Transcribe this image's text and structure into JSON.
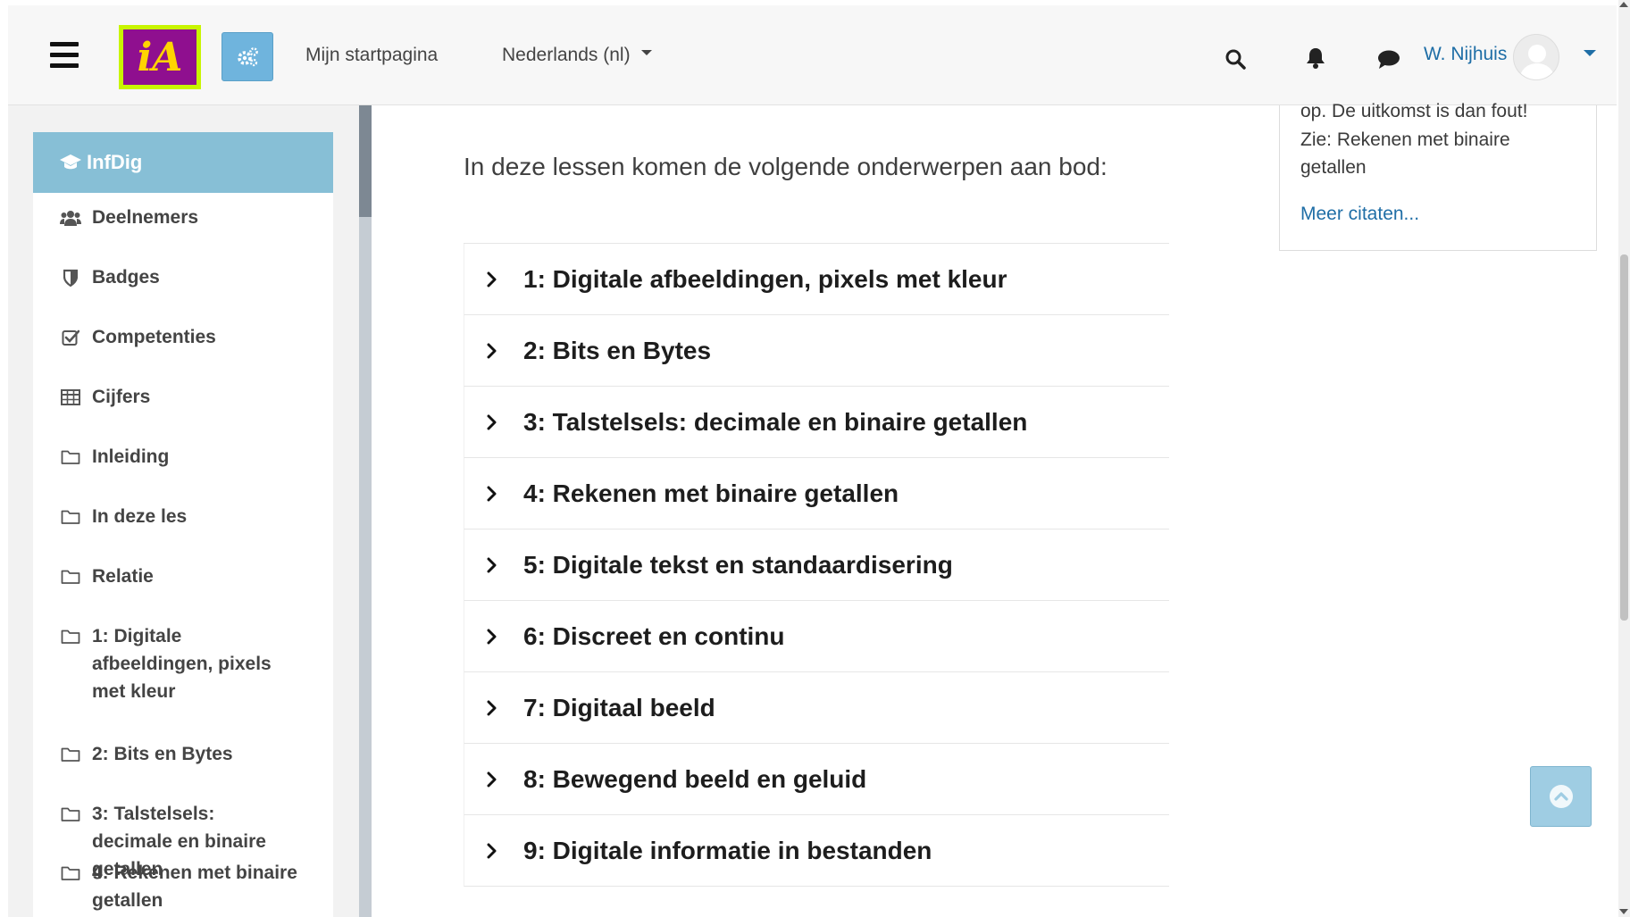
{
  "navbar": {
    "logo_text": "iA",
    "home_link": "Mijn startpagina",
    "language_label": "Nederlands (nl)",
    "user_name": "W. Nijhuis",
    "icons": [
      "menu-icon",
      "cogs-icon",
      "search-icon",
      "bell-icon",
      "comment-icon",
      "avatar",
      "caret-down-icon"
    ]
  },
  "drawer": {
    "course": {
      "label": "InfDig",
      "icon": "graduation-cap-icon"
    },
    "items": [
      {
        "label": "Deelnemers",
        "icon": "users-icon"
      },
      {
        "label": "Badges",
        "icon": "shield-icon"
      },
      {
        "label": "Competenties",
        "icon": "check-square-icon"
      },
      {
        "label": "Cijfers",
        "icon": "table-icon"
      },
      {
        "label": "Inleiding",
        "icon": "folder-icon"
      },
      {
        "label": "In deze les",
        "icon": "folder-icon"
      },
      {
        "label": "Relatie",
        "icon": "folder-icon"
      },
      {
        "label": "1: Digitale afbeeldingen, pixels met kleur",
        "icon": "folder-icon"
      },
      {
        "label": "2: Bits en Bytes",
        "icon": "folder-icon"
      },
      {
        "label": "3: Talstelsels: decimale en binaire getallen",
        "icon": "folder-icon"
      },
      {
        "label": "4: Rekenen met binaire getallen",
        "icon": "folder-icon"
      }
    ]
  },
  "main": {
    "intro": "In deze lessen komen de volgende onderwerpen aan bod:",
    "topics": [
      "1: Digitale afbeeldingen, pixels met kleur",
      "2: Bits en Bytes",
      "3: Talstelsels: decimale en binaire getallen",
      "4: Rekenen met binaire getallen",
      "5: Digitale tekst en standaardisering",
      "6: Discreet en continu",
      "7: Digitaal beeld",
      "8: Bewegend beeld en geluid",
      "9: Digitale informatie in bestanden"
    ]
  },
  "quote": {
    "line1": "op. De uitkomst is dan fout!",
    "line2": "Zie: Rekenen met binaire",
    "line3": "getallen",
    "more_link": "Meer citaten..."
  },
  "colors": {
    "accent": "#87bfd6",
    "link": "#1f6ea6",
    "logo_bg": "#c8f500",
    "logo_inner": "#8f0f8f"
  }
}
